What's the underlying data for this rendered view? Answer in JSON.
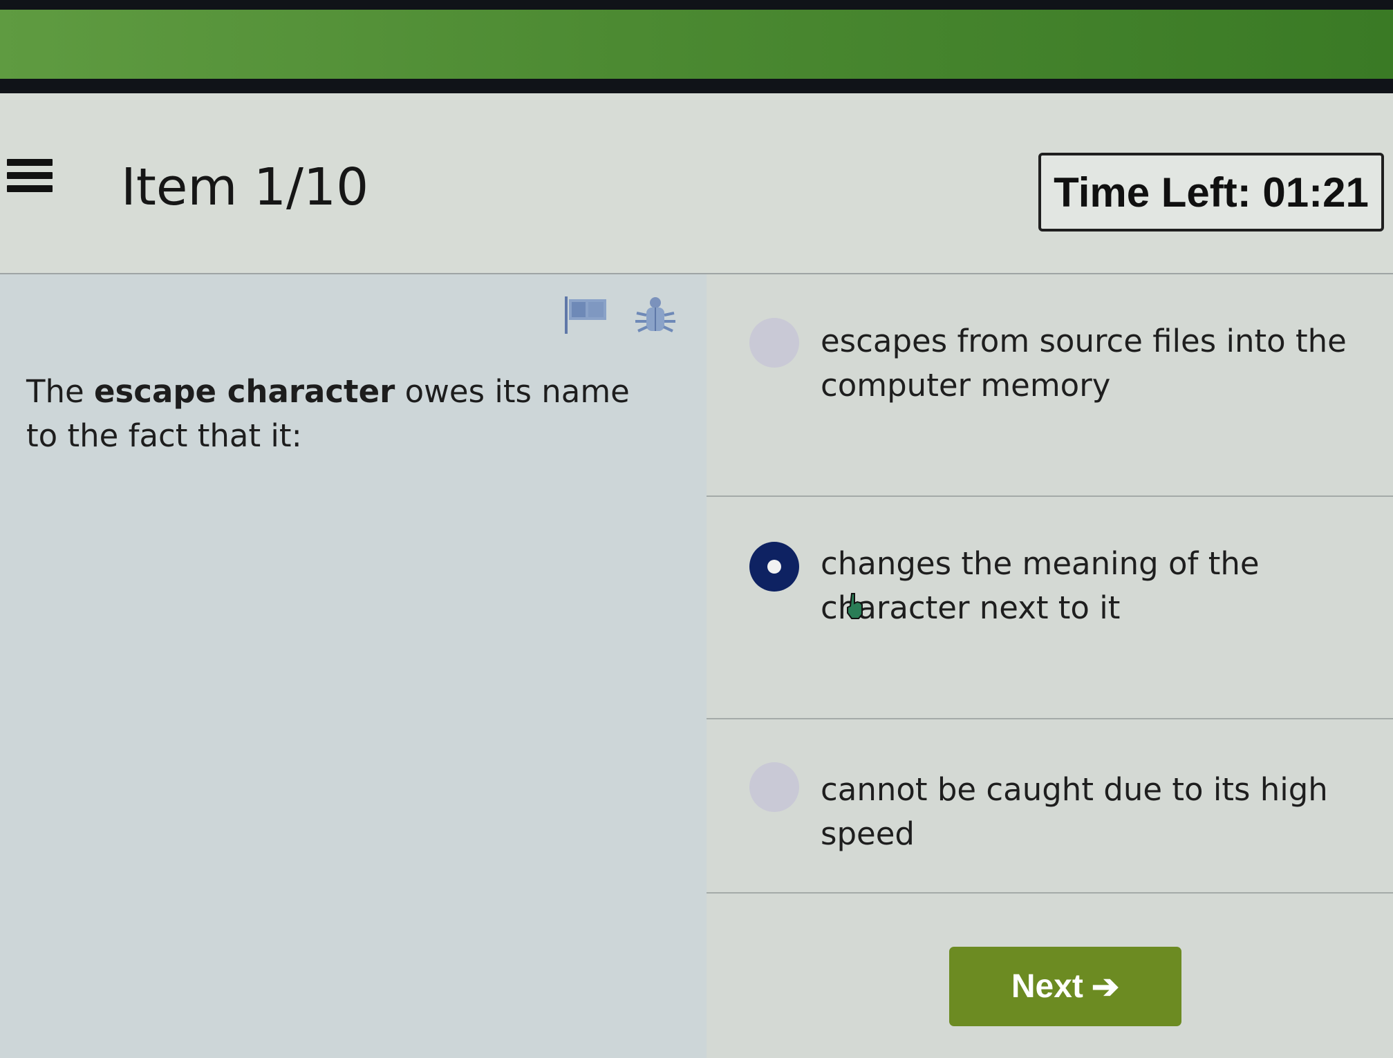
{
  "header": {
    "menu_icon": "hamburger-menu-icon",
    "item_label": "Item 1/10",
    "timer_label": "Time Left: 01:21"
  },
  "question": {
    "prefix": "The ",
    "bold": "escape character",
    "suffix": " owes its name to the fact that it:",
    "icons": [
      "flag-icon",
      "bug-icon"
    ]
  },
  "options": [
    {
      "text": "escapes from source files into the computer memory",
      "selected": false
    },
    {
      "text": "changes the meaning of the character next to it",
      "selected": true
    },
    {
      "text": "cannot be caught due to its high speed",
      "selected": false
    }
  ],
  "footer": {
    "next_label": "Next",
    "next_icon": "arrow-right-icon"
  },
  "colors": {
    "brand_green": "#4c8a32",
    "next_button": "#6c8b22",
    "radio_selected": "#0e2262",
    "radio_unselected": "#c9c9d6"
  }
}
